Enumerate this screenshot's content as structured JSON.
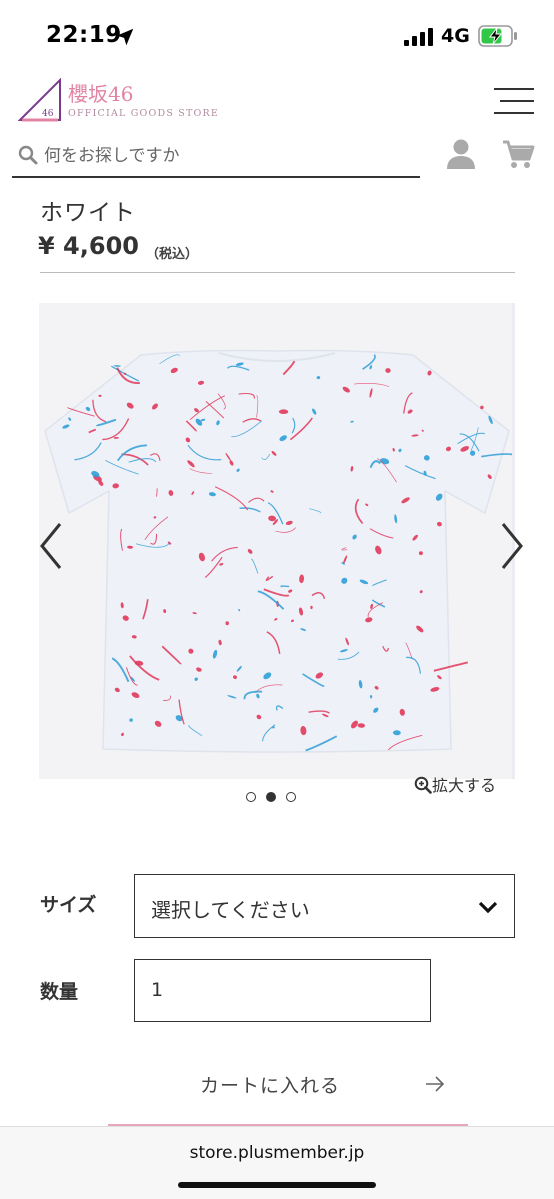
{
  "status_bar": {
    "time": "22:19",
    "network": "4G",
    "icons": [
      "location-arrow-icon",
      "signal-icon",
      "battery-charging-icon"
    ]
  },
  "header": {
    "logo": {
      "mark_text": "46",
      "name": "櫻坂46",
      "subtitle": "OFFICIAL GOODS STORE"
    },
    "icons": [
      "menu-icon"
    ]
  },
  "search": {
    "placeholder": "何をお探しですか",
    "value": "",
    "icons": [
      "search-icon",
      "user-icon",
      "cart-icon"
    ]
  },
  "product": {
    "name": "ホワイト",
    "price": "¥ 4,600",
    "tax_note": "（税込）"
  },
  "gallery": {
    "icons": [
      "chevron-left-icon",
      "chevron-right-icon",
      "zoom-in-icon"
    ],
    "zoom_label": "拡大する",
    "slide_count": 3,
    "active_slide": 2
  },
  "options": {
    "size_label": "サイズ",
    "size_selected": "選択してください",
    "quantity_label": "数量",
    "quantity_value": "1"
  },
  "add_to_cart": {
    "label": "カートに入れる",
    "icon": "arrow-right-icon"
  },
  "browser": {
    "url": "store.plusmember.jp"
  },
  "colors": {
    "brand_pink": "#e184a4",
    "logo_purple": "#7a3b8f",
    "splatter_red": "#e0385a",
    "splatter_blue": "#2f9fd6"
  }
}
